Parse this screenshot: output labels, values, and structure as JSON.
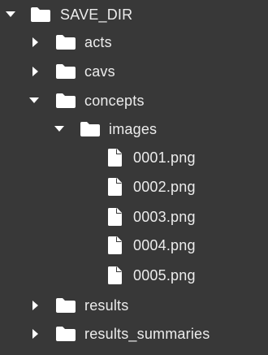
{
  "file_tree": {
    "root": {
      "label": "SAVE_DIR",
      "expanded": true,
      "icon": "folder-icon"
    },
    "items": [
      {
        "label": "acts",
        "type": "folder",
        "expanded": false,
        "icon": "folder-icon"
      },
      {
        "label": "cavs",
        "type": "folder",
        "expanded": false,
        "icon": "folder-icon"
      },
      {
        "label": "concepts",
        "type": "folder",
        "expanded": true,
        "icon": "folder-icon"
      },
      {
        "label": "images",
        "type": "folder",
        "expanded": true,
        "icon": "folder-icon"
      },
      {
        "label": "0001.png",
        "type": "file",
        "icon": "file-icon"
      },
      {
        "label": "0002.png",
        "type": "file",
        "icon": "file-icon"
      },
      {
        "label": "0003.png",
        "type": "file",
        "icon": "file-icon"
      },
      {
        "label": "0004.png",
        "type": "file",
        "icon": "file-icon"
      },
      {
        "label": "0005.png",
        "type": "file",
        "icon": "file-icon"
      },
      {
        "label": "results",
        "type": "folder",
        "expanded": false,
        "icon": "folder-icon"
      },
      {
        "label": "results_summaries",
        "type": "folder",
        "expanded": false,
        "icon": "folder-icon"
      }
    ]
  },
  "colors": {
    "background": "#383838",
    "text": "#ececec",
    "icon": "#ffffff",
    "chevron": "#ffffff"
  }
}
